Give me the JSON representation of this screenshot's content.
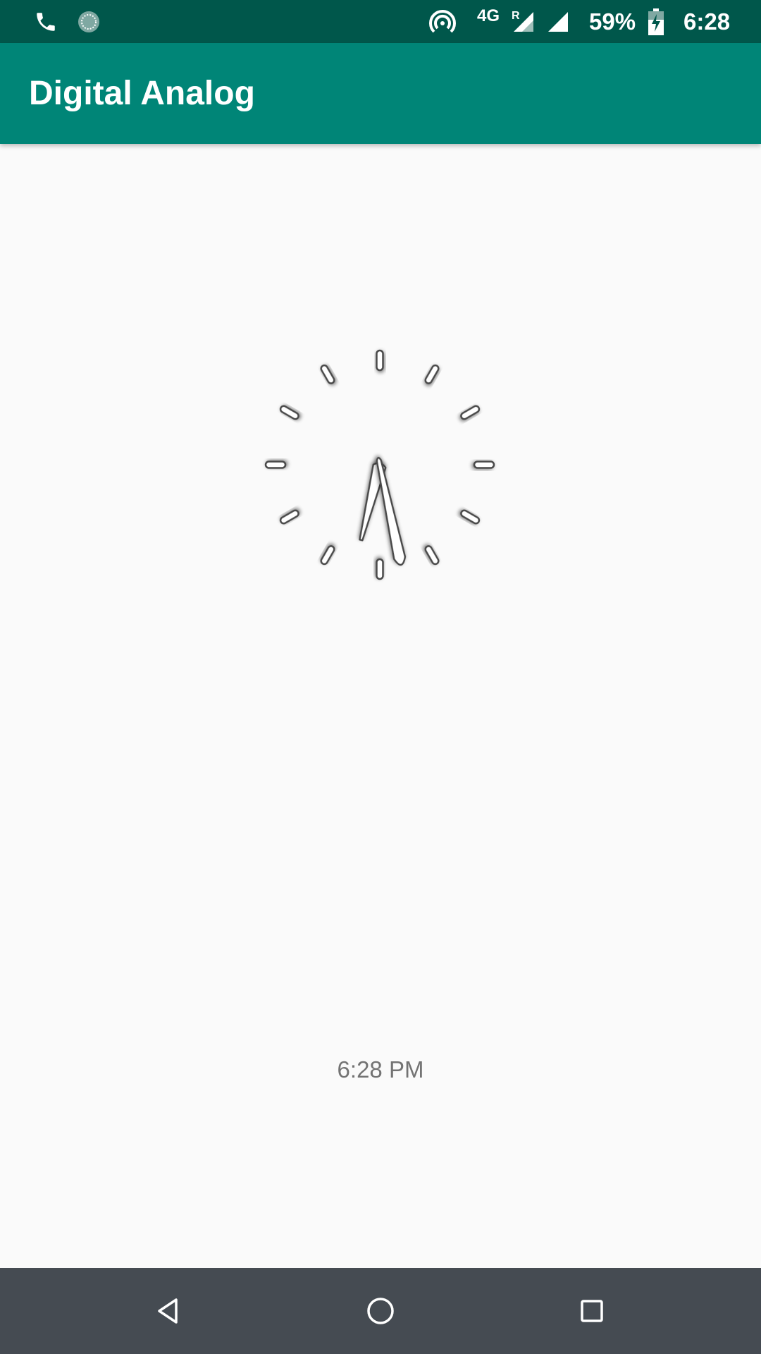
{
  "status_bar": {
    "network": "4G",
    "roaming": "R",
    "battery": "59%",
    "time": "6:28",
    "icons": [
      "phone-icon",
      "sync-icon",
      "hotspot-icon",
      "signal-roaming-icon",
      "signal-icon",
      "battery-charging-icon"
    ]
  },
  "app_bar": {
    "title": "Digital Analog"
  },
  "clock": {
    "hour": 6,
    "minute": 28,
    "digital_time": "6:28 PM"
  },
  "nav_bar": {
    "icons": [
      "back-icon",
      "home-icon",
      "recents-icon"
    ]
  },
  "colors": {
    "status_bar": "#00574b",
    "app_bar": "#008577",
    "background": "#fafafa",
    "nav_bar": "#454b52",
    "time_text": "#737373"
  }
}
